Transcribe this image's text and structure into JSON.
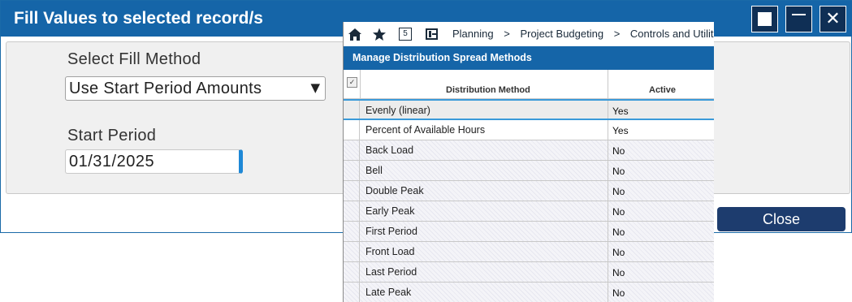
{
  "dialog": {
    "title": "Fill Values to selected record/s",
    "fill_method_label": "Select Fill Method",
    "fill_method_value": "Use Start Period Amounts",
    "start_period_label": "Start Period",
    "start_period_value": "01/31/2025",
    "close_label": "Close",
    "window_buttons": [
      "maximize-icon",
      "minimize-icon",
      "close-icon"
    ]
  },
  "overlay": {
    "nav_icons": [
      "home-icon",
      "star-icon",
      "five-badge-icon",
      "panel-icon"
    ],
    "five_badge": "5",
    "breadcrumb": [
      "Planning",
      "Project Budgeting",
      "Controls and Utilitie"
    ],
    "breadcrumb_sep": ">",
    "grid_title": "Manage Distribution Spread Methods",
    "columns": {
      "method": "Distribution Method",
      "active": "Active"
    },
    "rows": [
      {
        "method": "Evenly (linear)",
        "active": "Yes"
      },
      {
        "method": "Percent of Available Hours",
        "active": "Yes"
      },
      {
        "method": "Back Load",
        "active": "No"
      },
      {
        "method": "Bell",
        "active": "No"
      },
      {
        "method": "Double Peak",
        "active": "No"
      },
      {
        "method": "Early Peak",
        "active": "No"
      },
      {
        "method": "First Period",
        "active": "No"
      },
      {
        "method": "Front Load",
        "active": "No"
      },
      {
        "method": "Last Period",
        "active": "No"
      },
      {
        "method": "Late Peak",
        "active": "No"
      }
    ]
  },
  "colors": {
    "title_bar": "#1565a8",
    "window_button": "#0f2f55",
    "close_button": "#1d3c6e",
    "selected_row_border": "#3a9ad9"
  }
}
